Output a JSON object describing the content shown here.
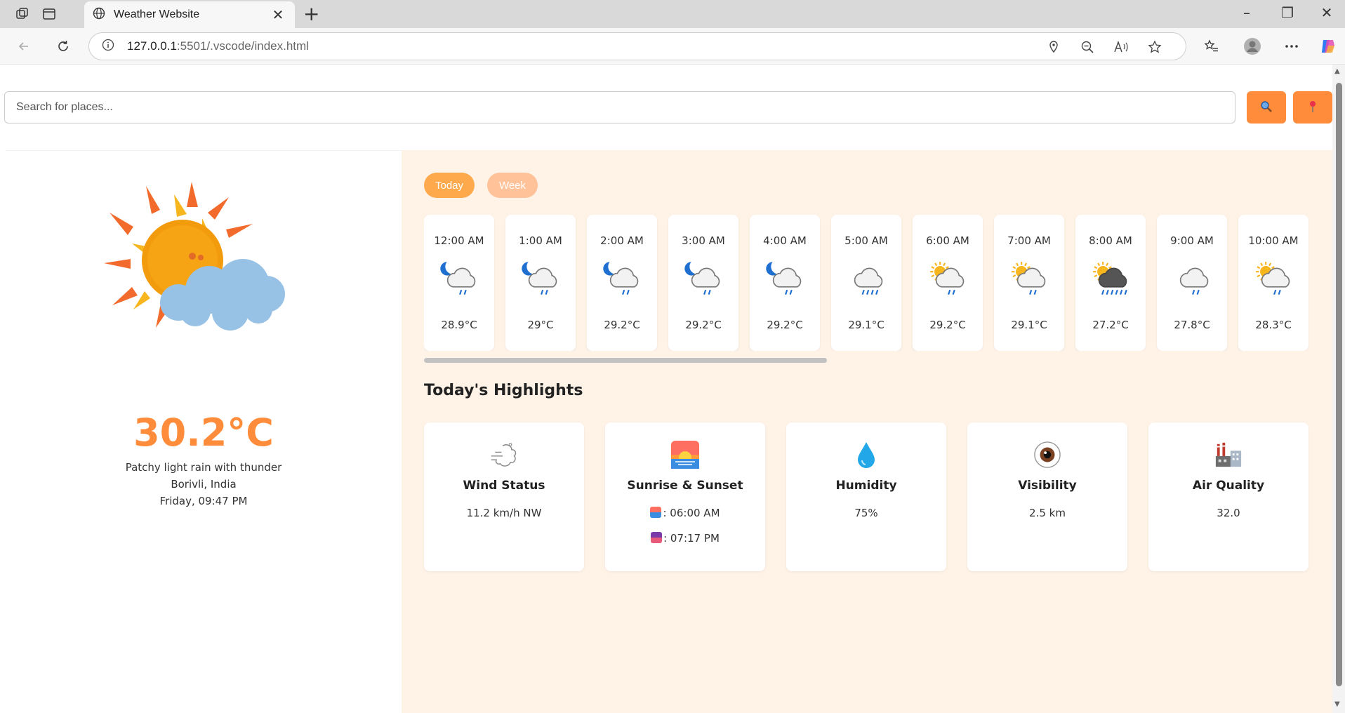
{
  "browser": {
    "tab_title": "Weather Website",
    "url_host": "127.0.0.1",
    "url_rest": ":5501/.vscode/index.html"
  },
  "search": {
    "placeholder": "Search for places..."
  },
  "current": {
    "temperature": "30.2°C",
    "condition": "Patchy light rain with thunder",
    "location": "Borivli, India",
    "datetime": "Friday, 09:47 PM"
  },
  "tabs": {
    "today": "Today",
    "week": "Week"
  },
  "hourly": [
    {
      "time": "12:00 AM",
      "temp": "28.9°C",
      "icon": "night-rain-icon"
    },
    {
      "time": "1:00 AM",
      "temp": "29°C",
      "icon": "night-rain-icon"
    },
    {
      "time": "2:00 AM",
      "temp": "29.2°C",
      "icon": "night-rain-icon"
    },
    {
      "time": "3:00 AM",
      "temp": "29.2°C",
      "icon": "night-rain-icon"
    },
    {
      "time": "4:00 AM",
      "temp": "29.2°C",
      "icon": "night-rain-icon"
    },
    {
      "time": "5:00 AM",
      "temp": "29.1°C",
      "icon": "drizzle-icon"
    },
    {
      "time": "6:00 AM",
      "temp": "29.2°C",
      "icon": "sun-rain-icon"
    },
    {
      "time": "7:00 AM",
      "temp": "29.1°C",
      "icon": "sun-rain-icon"
    },
    {
      "time": "8:00 AM",
      "temp": "27.2°C",
      "icon": "sun-heavy-rain-icon"
    },
    {
      "time": "9:00 AM",
      "temp": "27.8°C",
      "icon": "rain-icon"
    },
    {
      "time": "10:00 AM",
      "temp": "28.3°C",
      "icon": "sun-rain-icon"
    }
  ],
  "highlights": {
    "title": "Today's Highlights",
    "wind": {
      "label": "Wind Status",
      "value": "11.2 km/h NW"
    },
    "sun": {
      "label": "Sunrise & Sunset",
      "sunrise": ": 06:00 AM",
      "sunset": ": 07:17 PM"
    },
    "humidity": {
      "label": "Humidity",
      "value": "75%"
    },
    "visibility": {
      "label": "Visibility",
      "value": "2.5 km"
    },
    "air": {
      "label": "Air Quality",
      "value": "32.0"
    }
  },
  "colors": {
    "accent": "#ff8c3a",
    "panel_bg": "#fff2e6",
    "today_pill": "#ffa94d",
    "week_pill": "#ffc299"
  }
}
